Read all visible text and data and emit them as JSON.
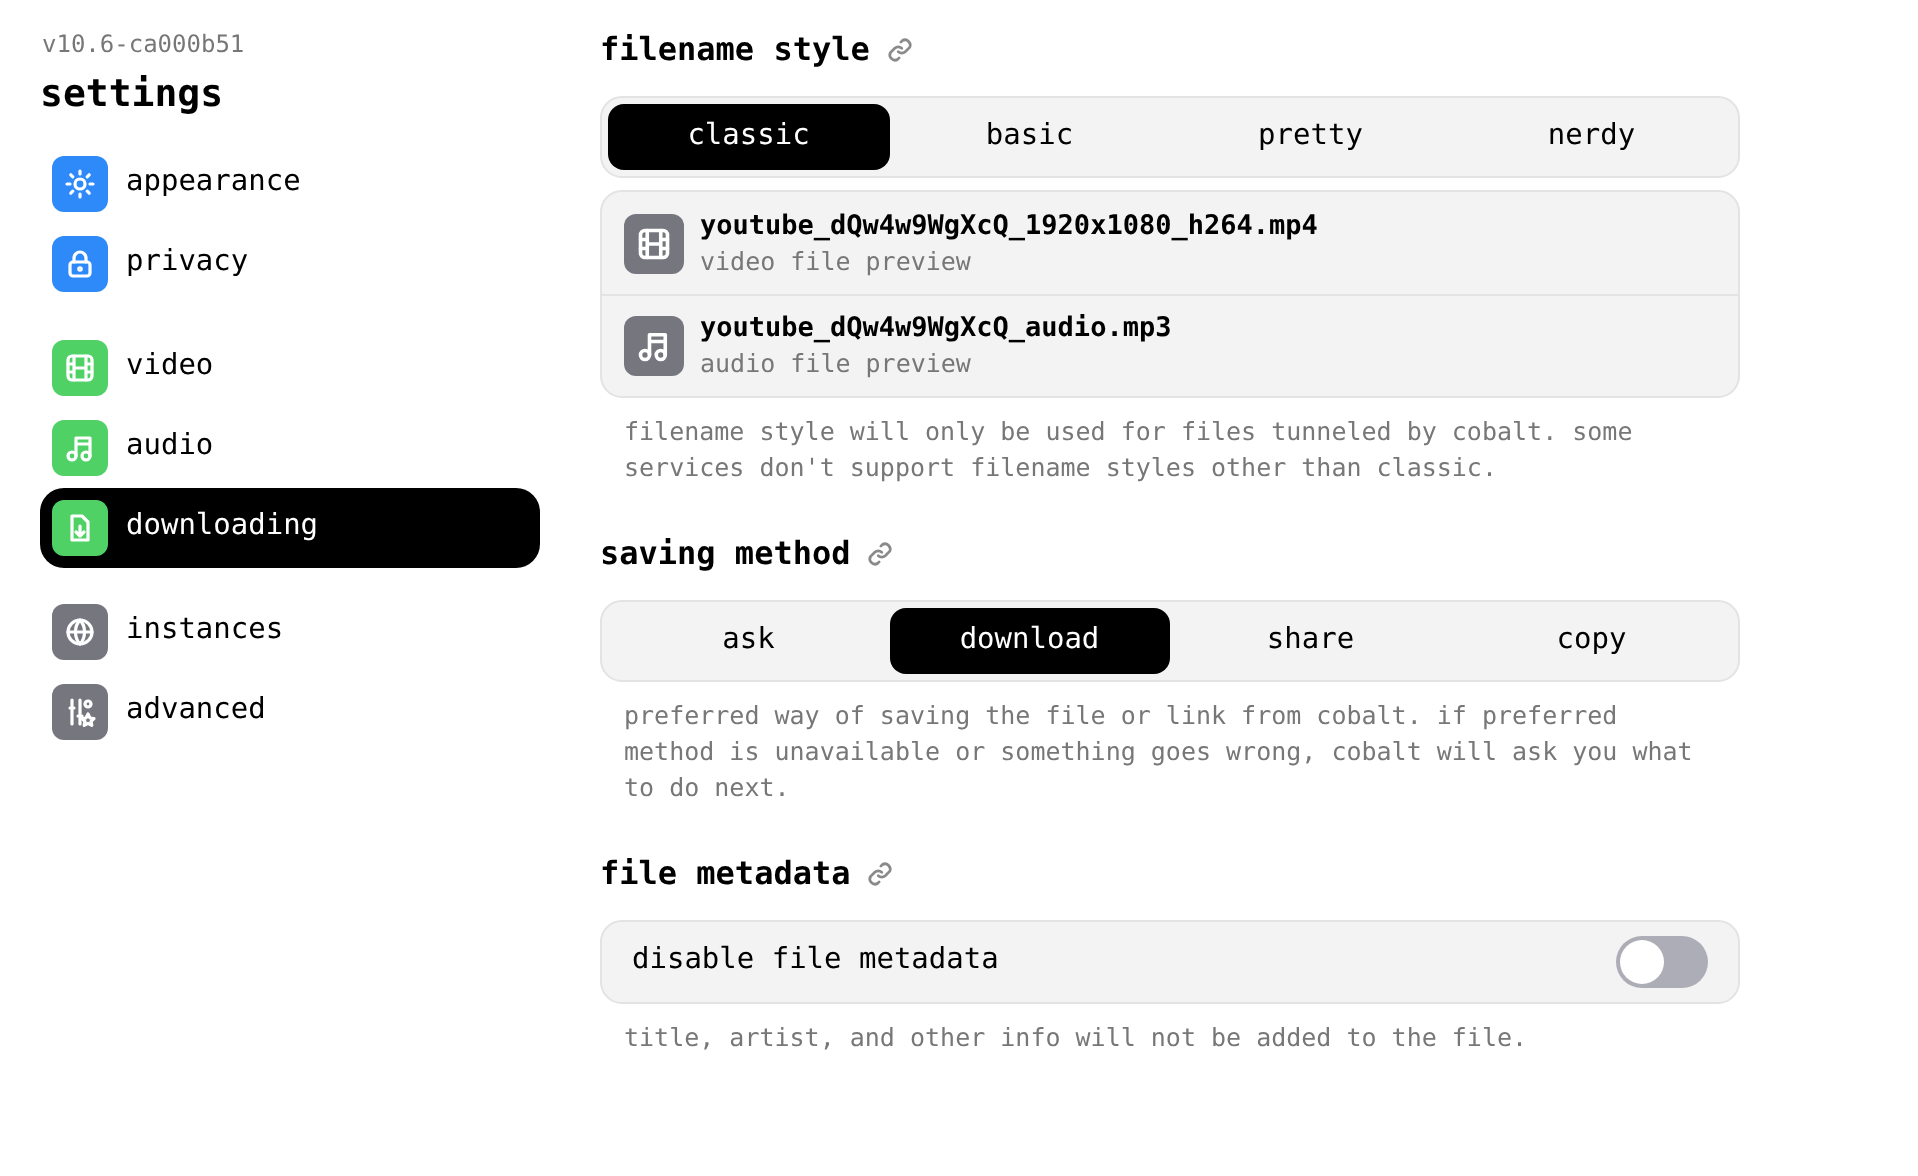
{
  "sidebar": {
    "version": "v10.6-ca000b51",
    "title": "settings",
    "groups": [
      [
        {
          "label": "appearance",
          "color": "#2f8af9",
          "selected": false
        },
        {
          "label": "privacy",
          "color": "#2f8af9",
          "selected": false
        }
      ],
      [
        {
          "label": "video",
          "color": "#4fd166",
          "selected": false
        },
        {
          "label": "audio",
          "color": "#4fd166",
          "selected": false
        },
        {
          "label": "downloading",
          "color": "#4fd166",
          "selected": true
        }
      ],
      [
        {
          "label": "instances",
          "color": "#76767f",
          "selected": false
        },
        {
          "label": "advanced",
          "color": "#76767f",
          "selected": false
        }
      ]
    ]
  },
  "sections": [
    {
      "title": "filename style",
      "kind": "switcher",
      "options": [
        {
          "label": "classic",
          "selected": true
        },
        {
          "label": "basic",
          "selected": false
        },
        {
          "label": "pretty",
          "selected": false
        },
        {
          "label": "nerdy",
          "selected": false
        }
      ],
      "previews": [
        {
          "kind": "video",
          "name": "youtube_dQw4w9WgXcQ_1920x1080_h264.mp4",
          "caption": "video file preview"
        },
        {
          "kind": "audio",
          "name": "youtube_dQw4w9WgXcQ_audio.mp3",
          "caption": "audio file preview"
        }
      ],
      "description": "filename style will only be used for files tunneled by cobalt. some services don't support filename styles other than classic."
    },
    {
      "title": "saving method",
      "kind": "switcher",
      "options": [
        {
          "label": "ask",
          "selected": false
        },
        {
          "label": "download",
          "selected": true
        },
        {
          "label": "share",
          "selected": false
        },
        {
          "label": "copy",
          "selected": false
        }
      ],
      "description": "preferred way of saving the file or link from cobalt. if preferred method is unavailable or something goes wrong, cobalt will ask you what to do next."
    },
    {
      "title": "file metadata",
      "kind": "toggle",
      "toggle": {
        "label": "disable file metadata",
        "on": false
      },
      "description": "title, artist, and other info will not be added to the file."
    }
  ]
}
